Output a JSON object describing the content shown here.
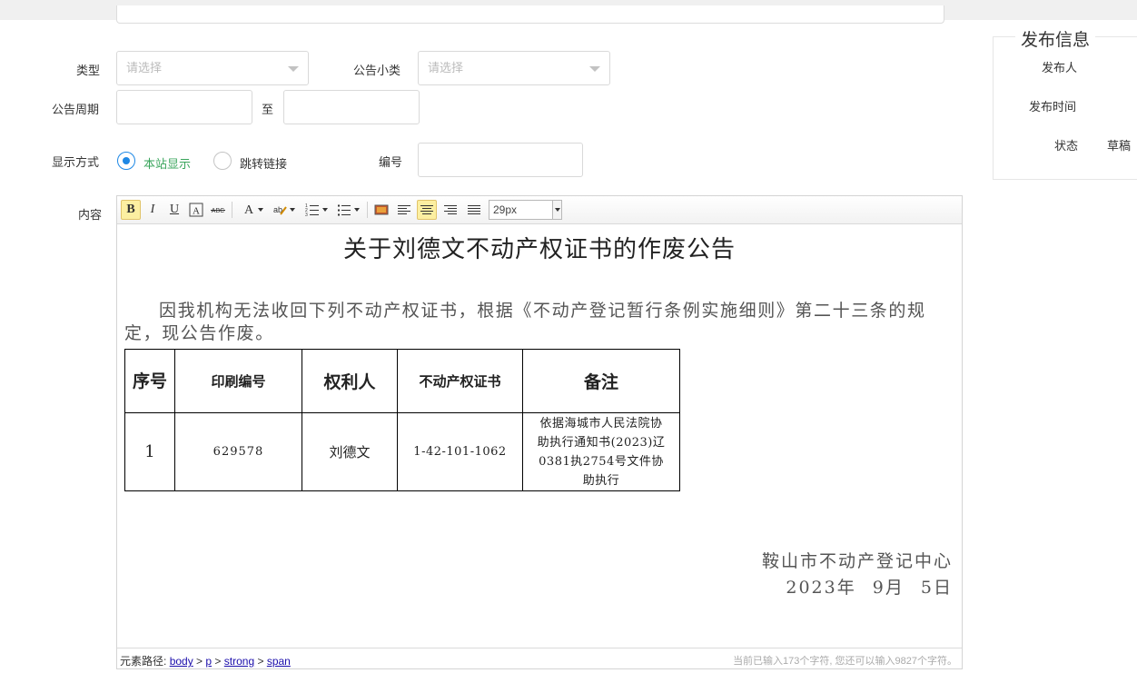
{
  "form": {
    "type_label": "类型",
    "type_placeholder": "请选择",
    "subtype_label": "公告小类",
    "subtype_placeholder": "请选择",
    "period_label": "公告周期",
    "period_separator": "至",
    "display_label": "显示方式",
    "display_options": [
      "本站显示",
      "跳转链接"
    ],
    "display_selected": "本站显示",
    "number_label": "编号",
    "content_label": "内容"
  },
  "toolbar": {
    "bold": "B",
    "italic": "I",
    "underline": "U",
    "font_size": "29px"
  },
  "document": {
    "title": "关于刘德文不动产权证书的作废公告",
    "paragraph": "因我机构无法收回下列不动产权证书，根据《不动产登记暂行条例实施细则》第二十三条的规定，现公告作废。",
    "table": {
      "headers": [
        "序号",
        "印刷编号",
        "权利人",
        "不动产权证书",
        "备注"
      ],
      "rows": [
        [
          "1",
          "629578",
          "刘德文",
          "1-42-101-1062",
          "依据海城市人民法院协助执行通知书(2023)辽0381执2754号文件协助执行"
        ]
      ]
    },
    "signature": "鞍山市不动产登记中心",
    "date": "2023年 9月 5日"
  },
  "statusbar": {
    "path_label": "元素路径:",
    "path": [
      "body",
      "p",
      "strong",
      "span"
    ],
    "char_count": "当前已输入173个字符, 您还可以输入9827个字符。"
  },
  "publish": {
    "title": "发布信息",
    "publisher_label": "发布人",
    "time_label": "发布时间",
    "status_label": "状态",
    "status_value": "草稿"
  }
}
